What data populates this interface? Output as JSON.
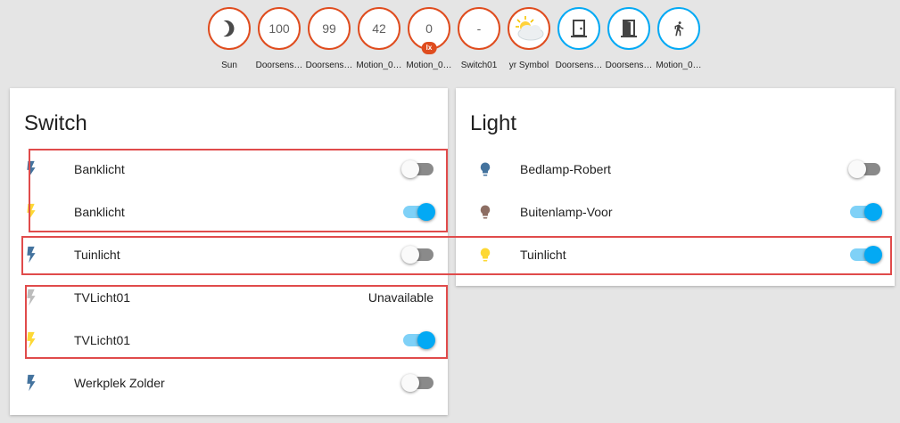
{
  "colors": {
    "badge_orange": "#df4c1e",
    "badge_blue": "#03a9f4",
    "toggle_on": "#03a9f4",
    "highlight_red": "#e04b4b",
    "icon_off_blue": "#44739e",
    "icon_on_yellow": "#fdd835",
    "icon_unavailable": "#bdbdbd",
    "bulb_brown": "#8d6e63"
  },
  "badges": [
    {
      "label": "Sun",
      "value": "",
      "icon": "moon-icon",
      "color": "orange"
    },
    {
      "label": "Doorsens…",
      "value": "100",
      "icon": "",
      "color": "orange"
    },
    {
      "label": "Doorsens…",
      "value": "99",
      "icon": "",
      "color": "orange"
    },
    {
      "label": "Motion_0…",
      "value": "42",
      "icon": "",
      "color": "orange"
    },
    {
      "label": "Motion_0…",
      "value": "0",
      "unit": "lx",
      "icon": "",
      "color": "orange"
    },
    {
      "label": "Switch01",
      "value": "-",
      "icon": "",
      "color": "orange"
    },
    {
      "label": "yr Symbol",
      "value": "",
      "icon": "partly-cloudy-icon",
      "color": "orange"
    },
    {
      "label": "Doorsens…",
      "value": "",
      "icon": "door-closed-icon",
      "color": "blue"
    },
    {
      "label": "Doorsens…",
      "value": "",
      "icon": "door-open-icon",
      "color": "blue"
    },
    {
      "label": "Motion_0…",
      "value": "",
      "icon": "walking-person-icon",
      "color": "blue"
    }
  ],
  "switch_card": {
    "title": "Switch",
    "rows": [
      {
        "name": "Banklicht",
        "icon": "flash-icon",
        "state": "off"
      },
      {
        "name": "Banklicht",
        "icon": "flash-icon",
        "state": "on"
      },
      {
        "name": "Tuinlicht",
        "icon": "flash-icon",
        "state": "off"
      },
      {
        "name": "TVLicht01",
        "icon": "flash-icon",
        "state": "unavailable",
        "status_text": "Unavailable"
      },
      {
        "name": "TVLicht01",
        "icon": "flash-icon",
        "state": "on"
      },
      {
        "name": "Werkplek Zolder",
        "icon": "flash-icon",
        "state": "off"
      }
    ]
  },
  "light_card": {
    "title": "Light",
    "rows": [
      {
        "name": "Bedlamp-Robert",
        "icon": "lightbulb-icon",
        "state": "off"
      },
      {
        "name": "Buitenlamp-Voor",
        "icon": "lightbulb-icon",
        "state": "on"
      },
      {
        "name": "Tuinlicht",
        "icon": "lightbulb-icon",
        "state": "on"
      }
    ]
  }
}
